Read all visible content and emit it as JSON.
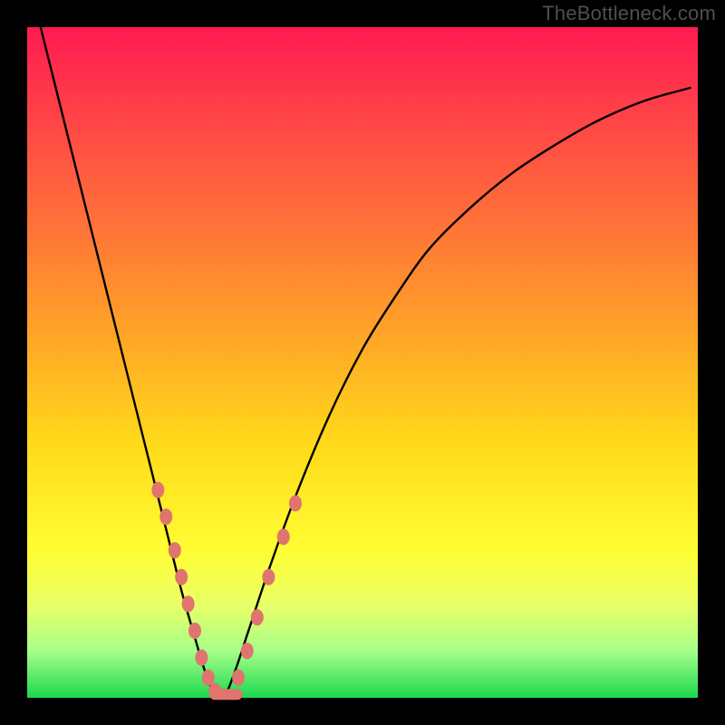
{
  "watermark": "TheBottleneck.com",
  "chart_data": {
    "type": "line",
    "title": "",
    "xlabel": "",
    "ylabel": "",
    "xlim": [
      0,
      100
    ],
    "ylim": [
      0,
      100
    ],
    "note": "Values are read off the plotted curve in normalized percent units (0–100). x is horizontal position, y is vertical height of the curve from the bottom.",
    "series": [
      {
        "name": "bottleneck-curve",
        "x": [
          2,
          5,
          8,
          11,
          14,
          17,
          19,
          21,
          23,
          25,
          26.5,
          28,
          29.5,
          31,
          33,
          36,
          40,
          45,
          50,
          55,
          60,
          66,
          72,
          78,
          85,
          92,
          99
        ],
        "y": [
          100,
          88,
          76,
          64,
          52,
          40,
          32,
          24,
          16,
          9,
          4,
          0.5,
          0.5,
          4,
          10,
          19,
          30,
          42,
          52,
          60,
          67,
          73,
          78,
          82,
          86,
          89,
          91
        ]
      }
    ],
    "markers": [
      {
        "name": "left-branch-markers",
        "color": "#e0746f",
        "points": [
          {
            "x": 19.5,
            "y": 31
          },
          {
            "x": 20.7,
            "y": 27
          },
          {
            "x": 22.0,
            "y": 22
          },
          {
            "x": 23.0,
            "y": 18
          },
          {
            "x": 24.0,
            "y": 14
          },
          {
            "x": 25.0,
            "y": 10
          },
          {
            "x": 26.0,
            "y": 6
          },
          {
            "x": 27.0,
            "y": 3
          },
          {
            "x": 28.0,
            "y": 1
          }
        ]
      },
      {
        "name": "trough-markers",
        "color": "#e0746f",
        "shape": "capsule",
        "points": [
          {
            "x": 28.8,
            "y": 0.5
          },
          {
            "x": 30.5,
            "y": 0.5
          }
        ]
      },
      {
        "name": "right-branch-markers",
        "color": "#e0746f",
        "points": [
          {
            "x": 31.5,
            "y": 3
          },
          {
            "x": 32.8,
            "y": 7
          },
          {
            "x": 34.3,
            "y": 12
          },
          {
            "x": 36.0,
            "y": 18
          },
          {
            "x": 38.2,
            "y": 24
          },
          {
            "x": 40.0,
            "y": 29
          }
        ]
      }
    ],
    "colors": {
      "curve": "#000000",
      "marker_fill": "#e0746f",
      "background_top": "#ff1a53",
      "background_bottom": "#1bd84f"
    }
  }
}
